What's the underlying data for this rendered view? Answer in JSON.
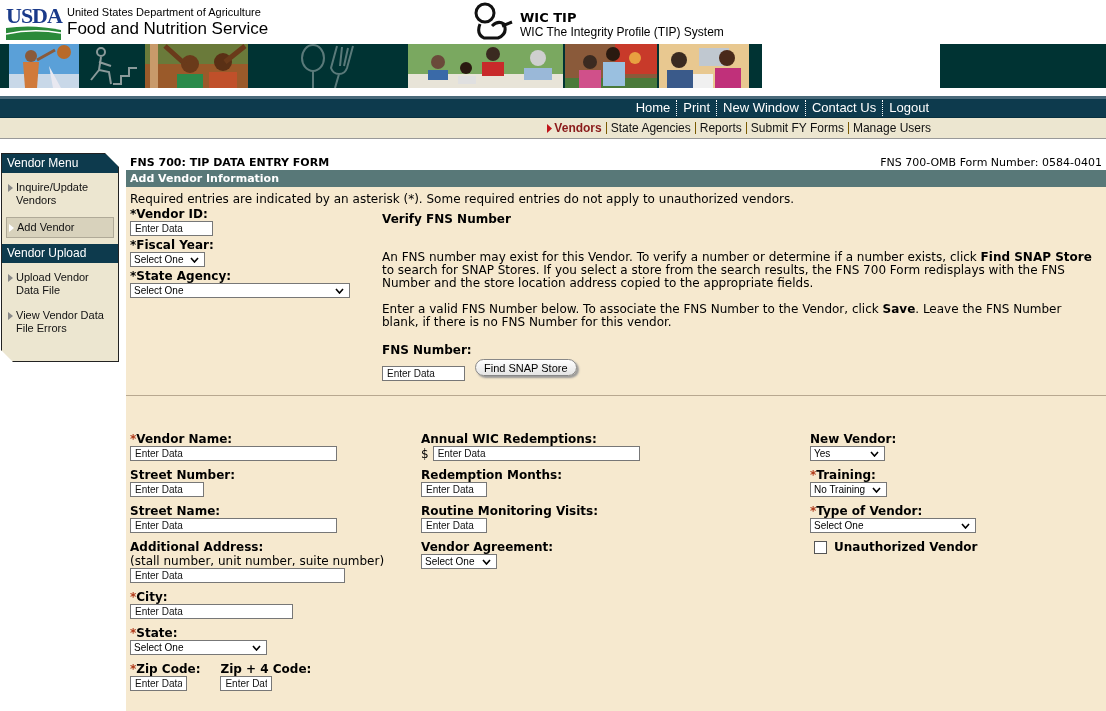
{
  "header": {
    "logo_text": "USDA",
    "agency": "United States Department of Agriculture",
    "service": "Food and Nutrition Service",
    "app_title": "WIC TIP",
    "app_subtitle": "WIC The Integrity Profile (TIP) System"
  },
  "banner": [
    {
      "kind": "picture"
    },
    {
      "kind": "stairs"
    },
    {
      "kind": "picture"
    },
    {
      "kind": "utensils"
    },
    {
      "kind": "picture"
    },
    {
      "kind": "picture"
    },
    {
      "kind": "picture"
    }
  ],
  "nav": [
    "Home",
    "Print",
    "New Window",
    "Contact Us",
    "Logout"
  ],
  "subnav": [
    {
      "label": "Vendors",
      "selected": true
    },
    {
      "label": "State Agencies",
      "selected": false
    },
    {
      "label": "Reports",
      "selected": false
    },
    {
      "label": "Submit FY Forms",
      "selected": false
    },
    {
      "label": "Manage Users",
      "selected": false
    }
  ],
  "sidebar": [
    {
      "title": "Vendor Menu",
      "items": [
        {
          "label": "Inquire/Update Vendors",
          "selected": false
        },
        {
          "label": "Add Vendor",
          "selected": true
        }
      ]
    },
    {
      "title": "Vendor Upload",
      "items": [
        {
          "label": "Upload Vendor Data File",
          "selected": false
        },
        {
          "label": "View Vendor Data File Errors",
          "selected": false
        }
      ]
    }
  ],
  "form": {
    "title": "FNS 700: TIP DATA ENTRY FORM",
    "omb": "FNS 700-OMB Form Number: 0584-0401",
    "section_title": "Add Vendor Information",
    "note": "Required entries are indicated by an asterisk (*). Some required entries do not apply to unauthorized vendors.",
    "top_fields": [
      {
        "kind": "input",
        "mark": "*",
        "label": "Vendor ID:",
        "placeholder": "Enter Data"
      },
      {
        "kind": "select",
        "mark": "*",
        "label": "Fiscal Year:",
        "value": "Select One"
      },
      {
        "kind": "select",
        "mark": "*",
        "label": "State Agency:",
        "value": "Select One"
      }
    ],
    "verify": {
      "heading": "Verify FNS Number",
      "paragraphs": [
        "An FNS number may exist for this Vendor. To verify a number or determine if a number exists, click **Find SNAP Store** to search for SNAP Stores. If you select a store from the search results, the FNS 700 Form redisplays with the FNS Number and the store location address copied to the appropriate fields.",
        "Enter a valid FNS Number below. To associate the FNS Number to the Vendor, click **Save**. Leave the FNS Number blank, if there is no FNS Number for this vendor."
      ],
      "field_label": "FNS Number:",
      "placeholder": "Enter Data",
      "button": "Find SNAP Store"
    },
    "columns": [
      [
        {
          "kind": "input",
          "mark": "*",
          "label": "Vendor Name:",
          "placeholder": "Enter Data"
        },
        {
          "kind": "input",
          "label": "Street Number:",
          "placeholder": "Enter Data"
        },
        {
          "kind": "input",
          "label": "Street Name:",
          "placeholder": "Enter Data"
        },
        {
          "kind": "input",
          "label": "Additional Address:",
          "hint": "(stall number, unit number, suite number)",
          "placeholder": "Enter Data"
        },
        {
          "kind": "input",
          "mark": "*",
          "label": "City:",
          "placeholder": "Enter Data"
        },
        {
          "kind": "select",
          "mark": "*",
          "label": "State:",
          "value": "Select One"
        },
        {
          "kind": "pair",
          "fields": [
            {
              "kind": "input",
              "mark": "*",
              "label": "Zip Code:",
              "placeholder": "Enter Data"
            },
            {
              "kind": "input",
              "label": "Zip + 4 Code:",
              "placeholder": "Enter Dat"
            }
          ]
        }
      ],
      [
        {
          "kind": "input",
          "label": "Annual WIC Redemptions:",
          "prefix": "$",
          "placeholder": "Enter Data"
        },
        {
          "kind": "input",
          "label": "Redemption Months:",
          "placeholder": "Enter Data"
        },
        {
          "kind": "input",
          "label": "Routine Monitoring Visits:",
          "placeholder": "Enter Data"
        },
        {
          "kind": "select",
          "label": "Vendor Agreement:",
          "value": "Select One"
        }
      ],
      [
        {
          "kind": "select",
          "label": "New Vendor:",
          "value": "Yes"
        },
        {
          "kind": "select",
          "mark": "*",
          "label": "Training:",
          "value": "No Training"
        },
        {
          "kind": "select",
          "mark": "*",
          "label": "Type of Vendor:",
          "value": "Select One"
        },
        {
          "kind": "checkbox",
          "label": "Unauthorized Vendor",
          "checked": false
        }
      ]
    ]
  }
}
